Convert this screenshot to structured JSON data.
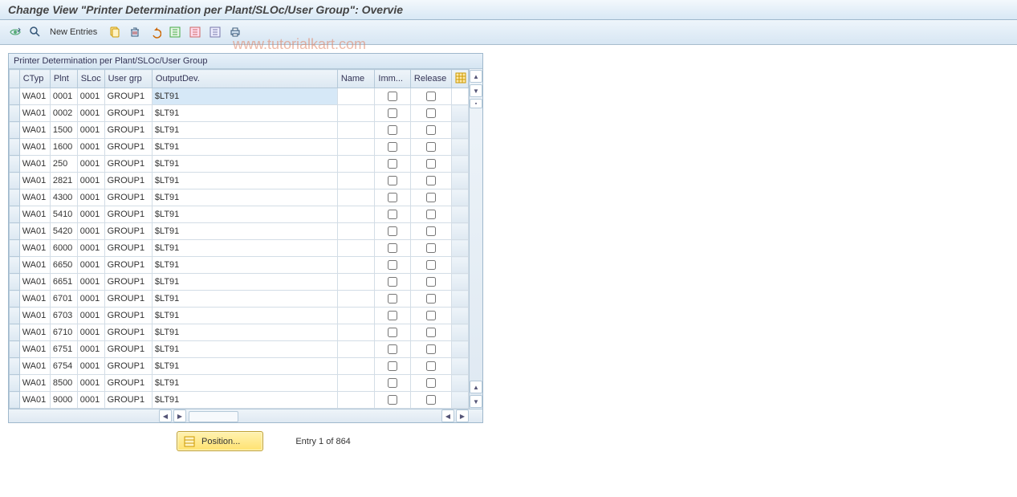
{
  "title": "Change View \"Printer Determination per Plant/SLOc/User Group\": Overvie",
  "toolbar": {
    "new_entries": "New Entries"
  },
  "watermark": "www.tutorialkart.com",
  "panel": {
    "title": "Printer Determination per Plant/SLOc/User Group",
    "headers": {
      "ctyp": "CTyp",
      "plnt": "Plnt",
      "sloc": "SLoc",
      "user_grp": "User grp",
      "outputdev": "OutputDev.",
      "name": "Name",
      "imm": "Imm...",
      "release": "Release"
    },
    "rows": [
      {
        "ctyp": "WA01",
        "plnt": "0001",
        "sloc": "0001",
        "ug": "GROUP1",
        "out": "$LT91"
      },
      {
        "ctyp": "WA01",
        "plnt": "0002",
        "sloc": "0001",
        "ug": "GROUP1",
        "out": "$LT91"
      },
      {
        "ctyp": "WA01",
        "plnt": "1500",
        "sloc": "0001",
        "ug": "GROUP1",
        "out": "$LT91"
      },
      {
        "ctyp": "WA01",
        "plnt": "1600",
        "sloc": "0001",
        "ug": "GROUP1",
        "out": "$LT91"
      },
      {
        "ctyp": "WA01",
        "plnt": "250",
        "sloc": "0001",
        "ug": "GROUP1",
        "out": "$LT91"
      },
      {
        "ctyp": "WA01",
        "plnt": "2821",
        "sloc": "0001",
        "ug": "GROUP1",
        "out": "$LT91"
      },
      {
        "ctyp": "WA01",
        "plnt": "4300",
        "sloc": "0001",
        "ug": "GROUP1",
        "out": "$LT91"
      },
      {
        "ctyp": "WA01",
        "plnt": "5410",
        "sloc": "0001",
        "ug": "GROUP1",
        "out": "$LT91"
      },
      {
        "ctyp": "WA01",
        "plnt": "5420",
        "sloc": "0001",
        "ug": "GROUP1",
        "out": "$LT91"
      },
      {
        "ctyp": "WA01",
        "plnt": "6000",
        "sloc": "0001",
        "ug": "GROUP1",
        "out": "$LT91"
      },
      {
        "ctyp": "WA01",
        "plnt": "6650",
        "sloc": "0001",
        "ug": "GROUP1",
        "out": "$LT91"
      },
      {
        "ctyp": "WA01",
        "plnt": "6651",
        "sloc": "0001",
        "ug": "GROUP1",
        "out": "$LT91"
      },
      {
        "ctyp": "WA01",
        "plnt": "6701",
        "sloc": "0001",
        "ug": "GROUP1",
        "out": "$LT91"
      },
      {
        "ctyp": "WA01",
        "plnt": "6703",
        "sloc": "0001",
        "ug": "GROUP1",
        "out": "$LT91"
      },
      {
        "ctyp": "WA01",
        "plnt": "6710",
        "sloc": "0001",
        "ug": "GROUP1",
        "out": "$LT91"
      },
      {
        "ctyp": "WA01",
        "plnt": "6751",
        "sloc": "0001",
        "ug": "GROUP1",
        "out": "$LT91"
      },
      {
        "ctyp": "WA01",
        "plnt": "6754",
        "sloc": "0001",
        "ug": "GROUP1",
        "out": "$LT91"
      },
      {
        "ctyp": "WA01",
        "plnt": "8500",
        "sloc": "0001",
        "ug": "GROUP1",
        "out": "$LT91"
      },
      {
        "ctyp": "WA01",
        "plnt": "9000",
        "sloc": "0001",
        "ug": "GROUP1",
        "out": "$LT91"
      }
    ]
  },
  "footer": {
    "position_label": "Position...",
    "entry_text": "Entry 1 of 864"
  }
}
